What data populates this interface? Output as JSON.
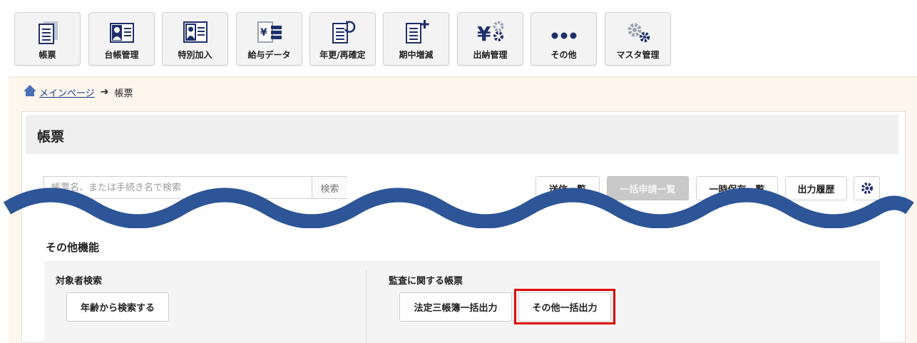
{
  "toolbar": {
    "items": [
      {
        "label": "帳票",
        "icon": "document-list-icon"
      },
      {
        "label": "台帳管理",
        "icon": "id-card-icon"
      },
      {
        "label": "特別加入",
        "icon": "person-card-icon"
      },
      {
        "label": "給与データ",
        "icon": "yen-data-icon"
      },
      {
        "label": "年更/再確定",
        "icon": "document-refresh-icon"
      },
      {
        "label": "期中増減",
        "icon": "document-plus-icon"
      },
      {
        "label": "出納管理",
        "icon": "yen-gear-icon"
      },
      {
        "label": "その他",
        "icon": "more-dots-icon"
      },
      {
        "label": "マスタ管理",
        "icon": "gears-icon"
      }
    ]
  },
  "breadcrumb": {
    "home_label": "メインページ",
    "current": "帳票"
  },
  "page": {
    "title": "帳票"
  },
  "search": {
    "placeholder": "帳票名、または手続き名で検索",
    "button_label": "検索"
  },
  "actions": {
    "send_list": "送信一覧",
    "bulk": "一括申請一覧",
    "temp_save": "一時保存一覧",
    "output_history": "出力履歴"
  },
  "other_functions": {
    "title": "その他機能",
    "target_search": {
      "heading": "対象者検索",
      "button": "年齢から検索する"
    },
    "audit": {
      "heading": "監査に関する帳票",
      "buttons": [
        "法定三帳簿一括出力",
        "その他一括出力"
      ]
    }
  },
  "colors": {
    "navy_icon": "#1f2f6b",
    "wave": "#2d5597",
    "highlight": "#e00000",
    "band": "#fdf6ec"
  }
}
